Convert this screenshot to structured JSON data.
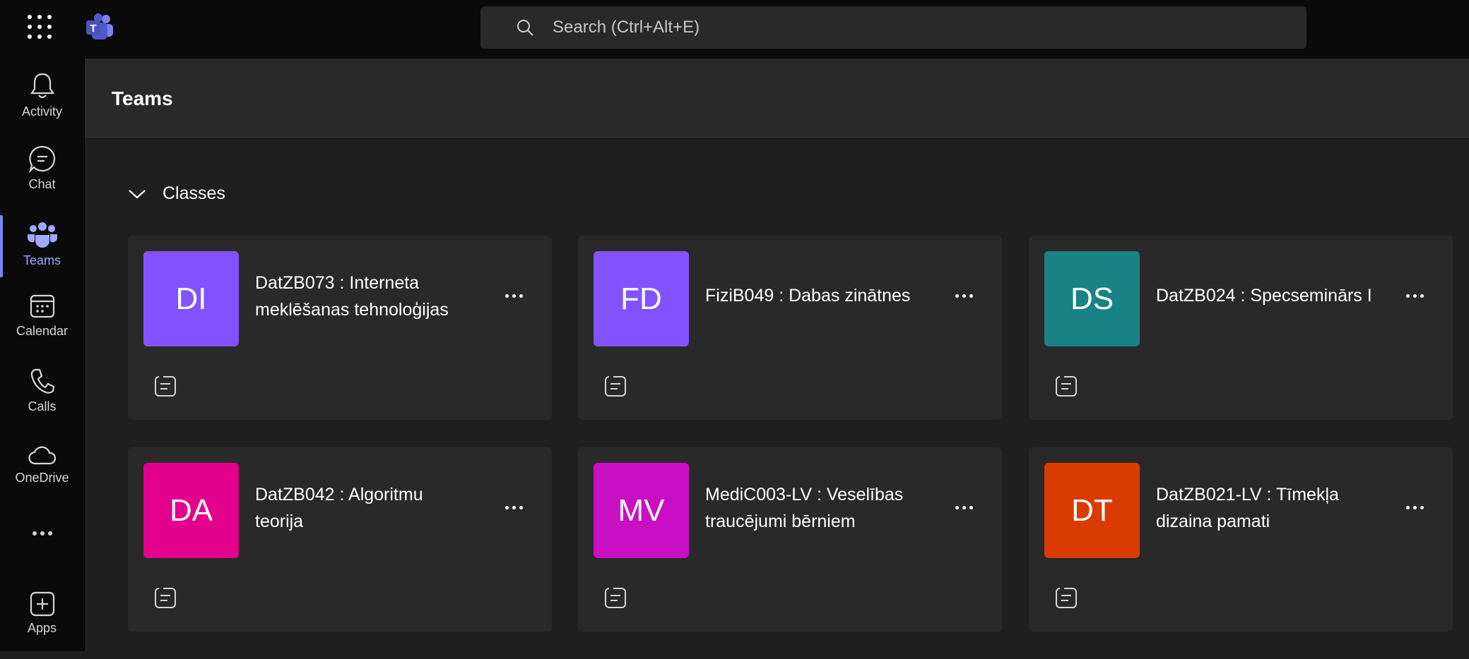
{
  "search": {
    "placeholder": "Search (Ctrl+Alt+E)"
  },
  "rail": {
    "items": [
      {
        "label": "Activity",
        "icon": "bell-icon"
      },
      {
        "label": "Chat",
        "icon": "chat-icon"
      },
      {
        "label": "Teams",
        "icon": "teams-icon",
        "active": true
      },
      {
        "label": "Calendar",
        "icon": "calendar-icon"
      },
      {
        "label": "Calls",
        "icon": "phone-icon"
      },
      {
        "label": "OneDrive",
        "icon": "cloud-icon"
      },
      {
        "label": "",
        "icon": "more-icon"
      },
      {
        "label": "Apps",
        "icon": "add-apps-icon"
      }
    ]
  },
  "header": {
    "title": "Teams"
  },
  "section": {
    "title": "Classes"
  },
  "teams": [
    {
      "initials": "DI",
      "name": "DatZB073 : Interneta meklēšanas tehnoloģijas",
      "color": "#8352ff"
    },
    {
      "initials": "FD",
      "name": "FiziB049 : Dabas zinātnes",
      "color": "#8352ff"
    },
    {
      "initials": "DS",
      "name": "DatZB024 : Specseminārs I",
      "color": "#198286"
    },
    {
      "initials": "DA",
      "name": "DatZB042 : Algoritmu teorija",
      "color": "#e3008c"
    },
    {
      "initials": "MV",
      "name": "MediC003-LV : Veselības traucējumi bērniem",
      "color": "#c90fc3"
    },
    {
      "initials": "DT",
      "name": "DatZB021-LV : Tīmekļa dizaina pamati",
      "color": "#da3b01"
    }
  ],
  "colors": {
    "accent": "#7f85f5",
    "rail_bg": "#0a0a0a",
    "card_bg": "#292929"
  }
}
